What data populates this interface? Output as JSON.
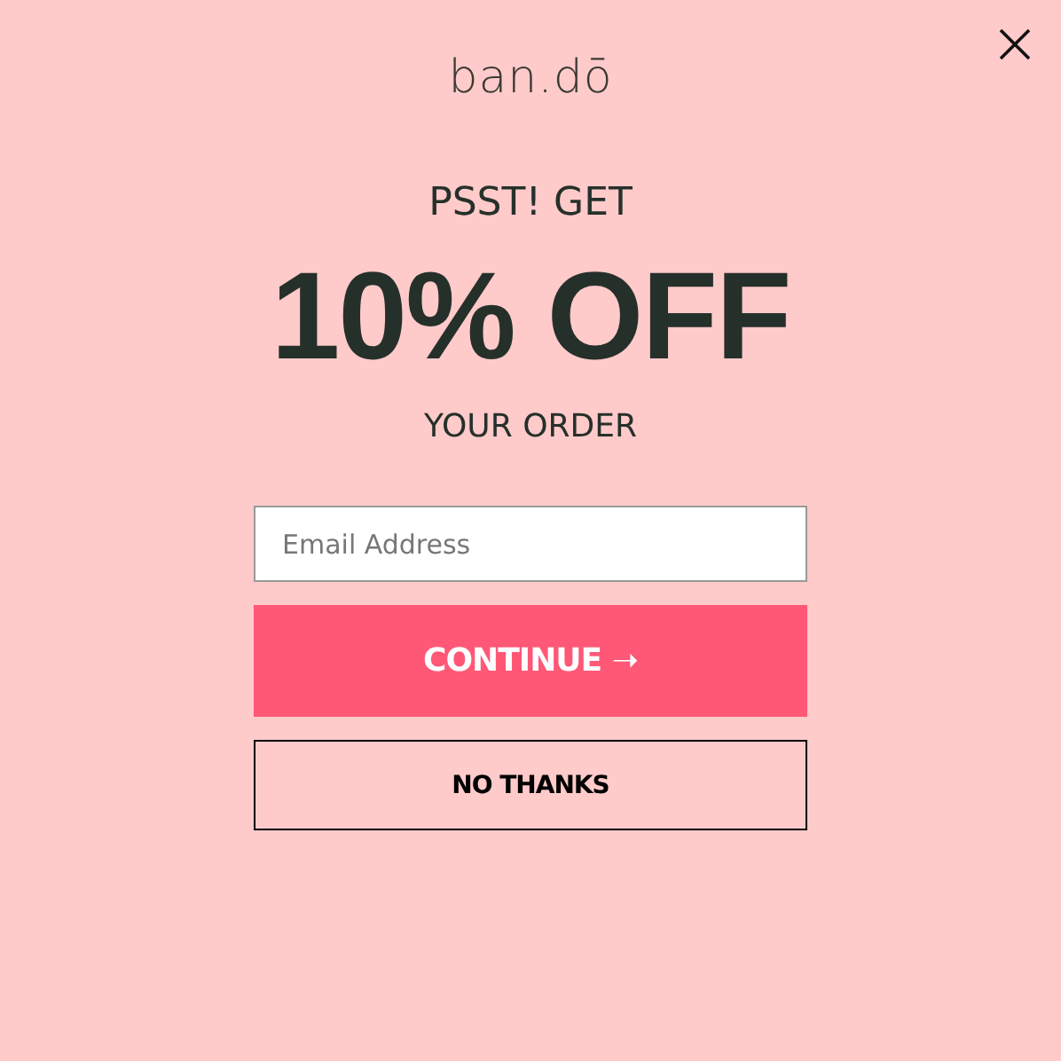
{
  "logo": "ban.dō",
  "headline": {
    "top": "PSST! GET",
    "main": "10% OFF",
    "bottom": "YOUR ORDER"
  },
  "email": {
    "placeholder": "Email Address"
  },
  "buttons": [
    {
      "kind": "primary",
      "label": "CONTINUE ➝"
    },
    {
      "kind": "outline",
      "label": "NO THANKS"
    }
  ]
}
